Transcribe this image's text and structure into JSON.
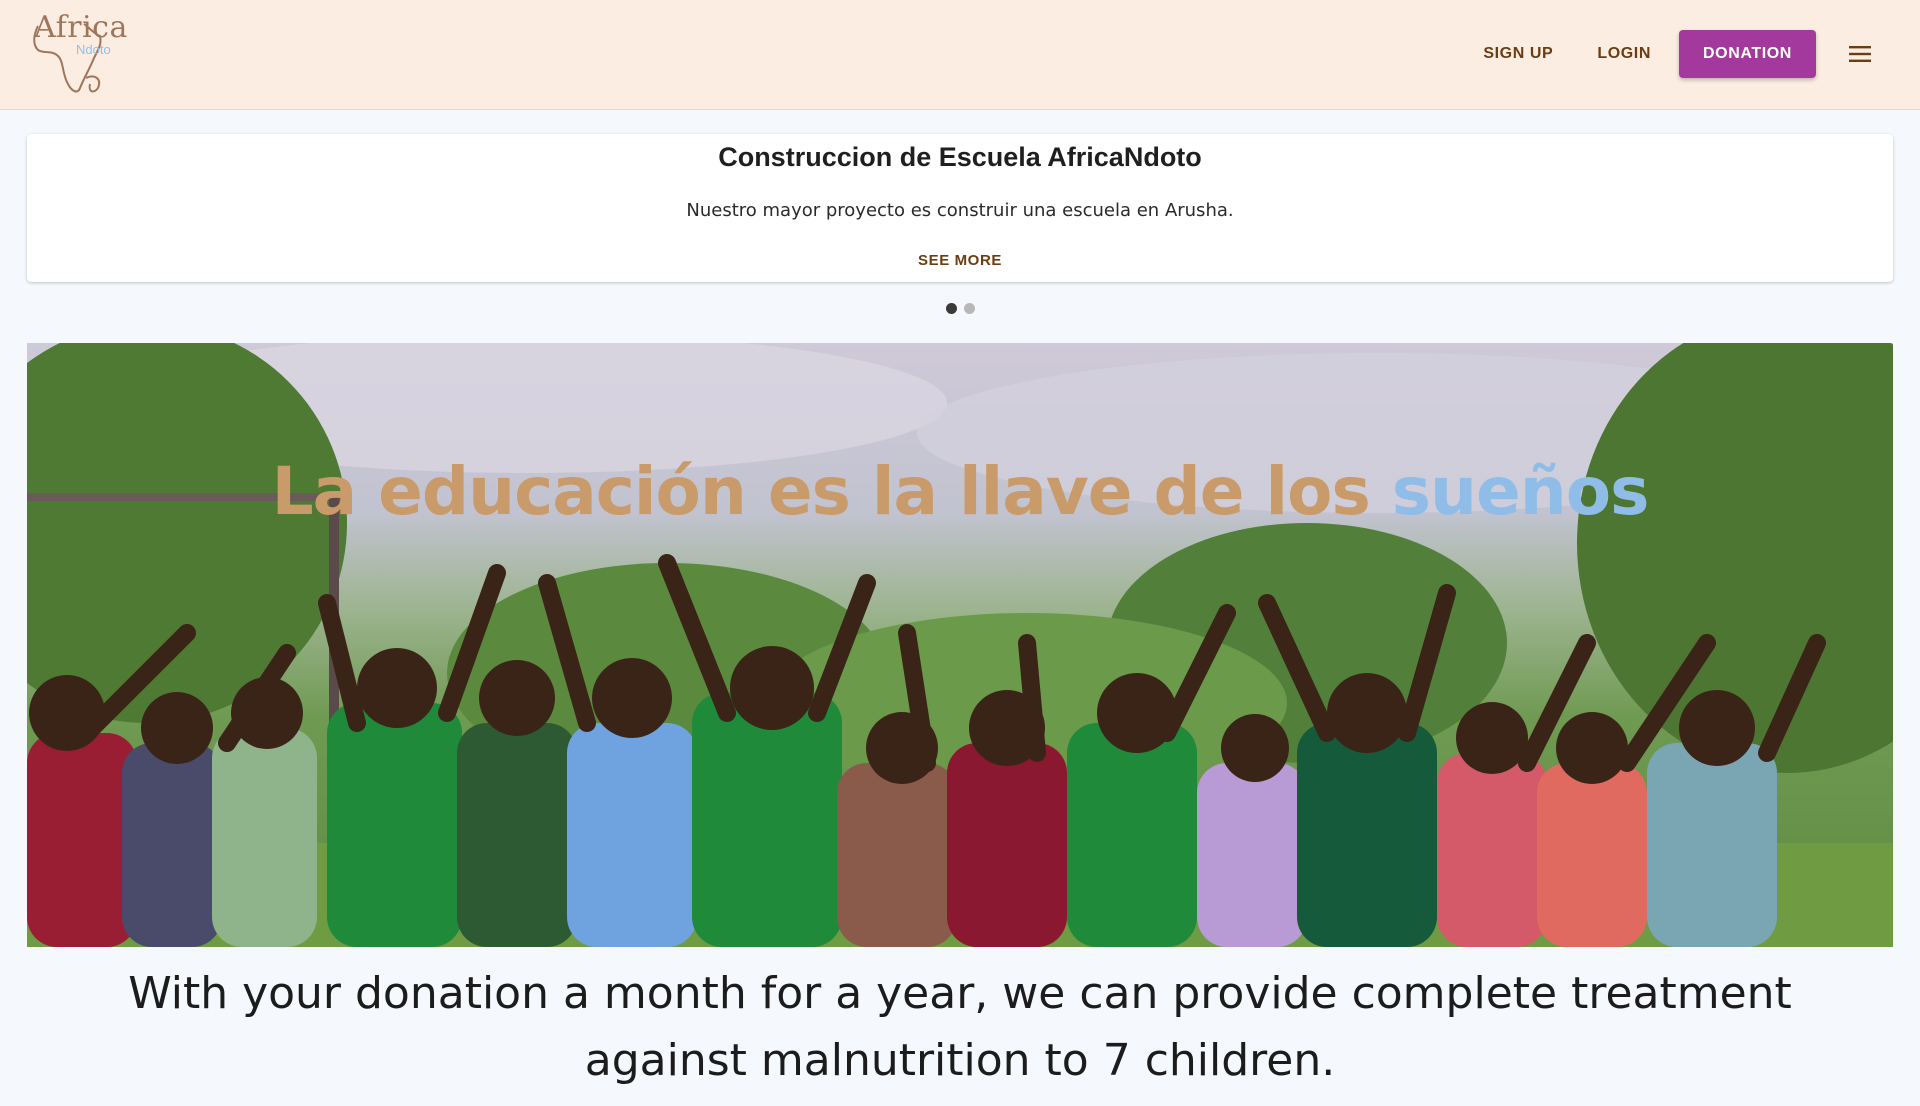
{
  "header": {
    "logo": {
      "word": "Africa",
      "sub": "Ndoto"
    },
    "nav": {
      "signup_label": "SIGN UP",
      "login_label": "LOGIN",
      "donation_label": "DONATION"
    },
    "icons": {
      "menu": "hamburger-menu-icon"
    }
  },
  "project_card": {
    "title": "Construccion de Escuela AfricaNdoto",
    "description": "Nuestro mayor proyecto es construir una escuela en Arusha.",
    "link_label": "SEE MORE"
  },
  "carousel": {
    "slides": 2,
    "active_index": 0
  },
  "hero": {
    "headline_main": "La educación es la llave de los ",
    "headline_accent": "sueños"
  },
  "message": "With your donation a month for a year, we can provide complete treatment against malnutrition to 7 children.",
  "colors": {
    "header_bg": "#fcede3",
    "page_bg": "#f5f8fd",
    "brand_brown": "#6b3d12",
    "donation_purple": "#a3399c",
    "headline_tan": "#c99a6a",
    "headline_blue": "#8fbde8"
  }
}
